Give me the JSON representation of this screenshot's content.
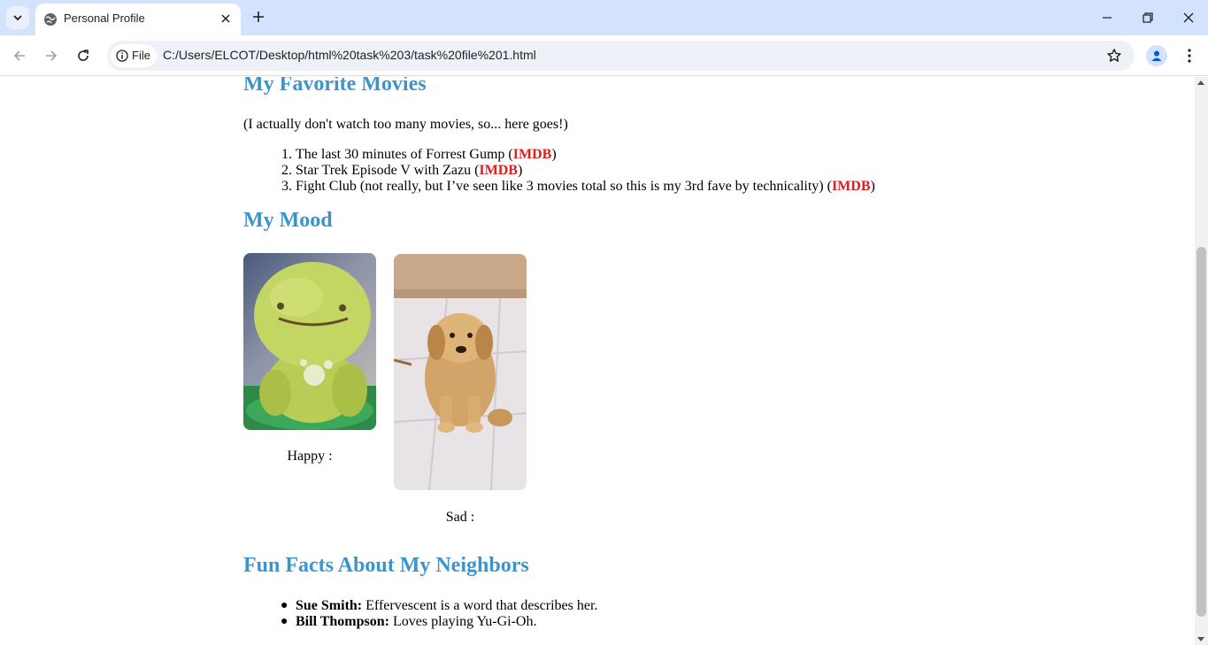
{
  "browser": {
    "tab_title": "Personal Profile",
    "chip_label": "File",
    "url": "C:/Users/ELCOT/Desktop/html%20task%203/task%20file%201.html"
  },
  "page": {
    "movies": {
      "heading": "My Favorite Movies",
      "intro": "(I actually don't watch too many movies, so... here goes!)",
      "items": [
        {
          "marker": "1.",
          "text": "The last 30 minutes of Forrest Gump (",
          "link": "IMDB",
          "after": ")"
        },
        {
          "marker": "2.",
          "text": "Star Trek Episode V with Zazu (",
          "link": "IMDB",
          "after": ")"
        },
        {
          "marker": "3.",
          "text": "Fight Club (not really, but I’ve seen like 3 movies total so this is my 3rd fave by technicality) (",
          "link": "IMDB",
          "after": ")"
        }
      ]
    },
    "mood": {
      "heading": "My Mood",
      "happy_caption": "Happy :",
      "sad_caption": "Sad :"
    },
    "neighbors": {
      "heading": "Fun Facts About My Neighbors",
      "items": [
        {
          "name": "Sue Smith:",
          "fact": " Effervescent is a word that describes her."
        },
        {
          "name": "Bill Thompson:",
          "fact": " Loves playing Yu-Gi-Oh."
        }
      ]
    }
  },
  "colors": {
    "heading": "#3a95cf",
    "link": "#e21b1b",
    "tabstrip": "#d3e3fd"
  }
}
